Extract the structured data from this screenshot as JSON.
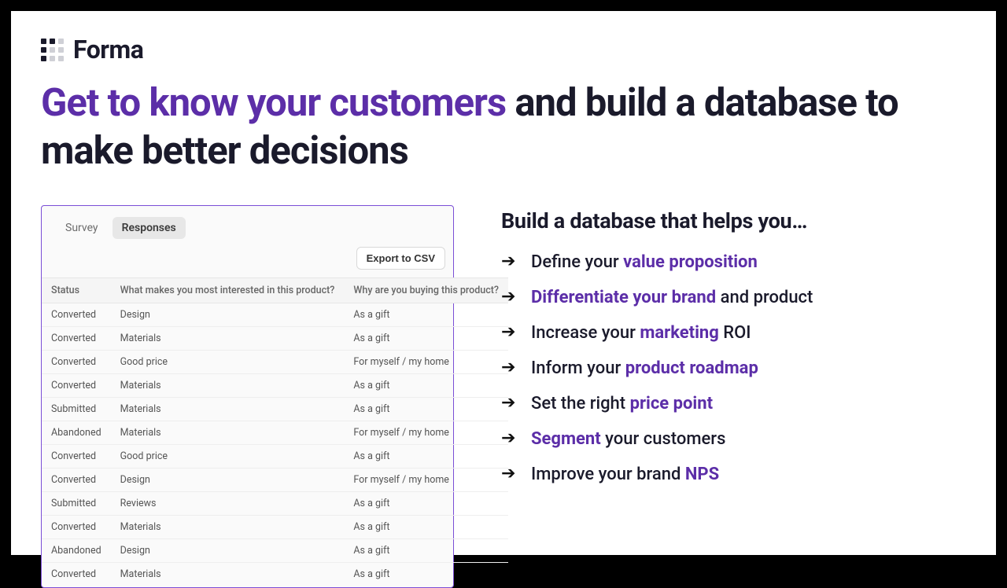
{
  "brand": {
    "name": "Forma"
  },
  "hero": {
    "lead": "Get to know your customers",
    "rest": " and build a database to make better decisions"
  },
  "panel": {
    "tabs": {
      "survey": "Survey",
      "responses": "Responses"
    },
    "export_label": "Export to CSV",
    "columns": {
      "status": "Status",
      "q1": "What makes you most interested in this product?",
      "q2": "Why are you buying this product?"
    },
    "rows": [
      {
        "status": "Converted",
        "q1": "Design",
        "q2": "As a gift"
      },
      {
        "status": "Converted",
        "q1": "Materials",
        "q2": "As a gift"
      },
      {
        "status": "Converted",
        "q1": "Good price",
        "q2": "For myself / my home"
      },
      {
        "status": "Converted",
        "q1": "Materials",
        "q2": "As a gift"
      },
      {
        "status": "Submitted",
        "q1": "Materials",
        "q2": "As a gift"
      },
      {
        "status": "Abandoned",
        "q1": "Materials",
        "q2": "For myself / my home"
      },
      {
        "status": "Converted",
        "q1": "Good price",
        "q2": "As a gift"
      },
      {
        "status": "Converted",
        "q1": "Design",
        "q2": "For myself / my home"
      },
      {
        "status": "Submitted",
        "q1": "Reviews",
        "q2": "As a gift"
      },
      {
        "status": "Converted",
        "q1": "Materials",
        "q2": "As a gift"
      },
      {
        "status": "Abandoned",
        "q1": "Design",
        "q2": "As a gift"
      },
      {
        "status": "Converted",
        "q1": "Materials",
        "q2": "As a gift"
      }
    ]
  },
  "rhs": {
    "title": "Build a database that helps you…",
    "bullets": [
      {
        "pre": "Define your ",
        "hl": "value proposition",
        "post": ""
      },
      {
        "pre": "",
        "hl": "Differentiate your brand",
        "post": " and product"
      },
      {
        "pre": "Increase your ",
        "hl": "marketing",
        "post": " ROI"
      },
      {
        "pre": "Inform your ",
        "hl": "product roadmap",
        "post": ""
      },
      {
        "pre": "Set the right ",
        "hl": "price point",
        "post": ""
      },
      {
        "pre": "",
        "hl": "Segment",
        "post": " your customers"
      },
      {
        "pre": "Improve your brand ",
        "hl": "NPS",
        "post": ""
      }
    ]
  }
}
